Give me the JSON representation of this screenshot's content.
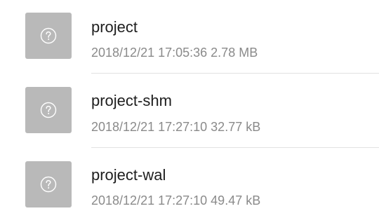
{
  "files": [
    {
      "name": "project",
      "date": "2018/12/21 17:05:36",
      "size": "2.78 MB",
      "icon": "unknown-file-icon"
    },
    {
      "name": "project-shm",
      "date": "2018/12/21 17:27:10",
      "size": "32.77 kB",
      "icon": "unknown-file-icon"
    },
    {
      "name": "project-wal",
      "date": "2018/12/21 17:27:10",
      "size": "49.47 kB",
      "icon": "unknown-file-icon"
    }
  ],
  "colors": {
    "icon_bg": "#b9b9b9",
    "name_text": "#1e1e1e",
    "meta_text": "#8a8a8a",
    "divider": "#e2e2e2"
  }
}
